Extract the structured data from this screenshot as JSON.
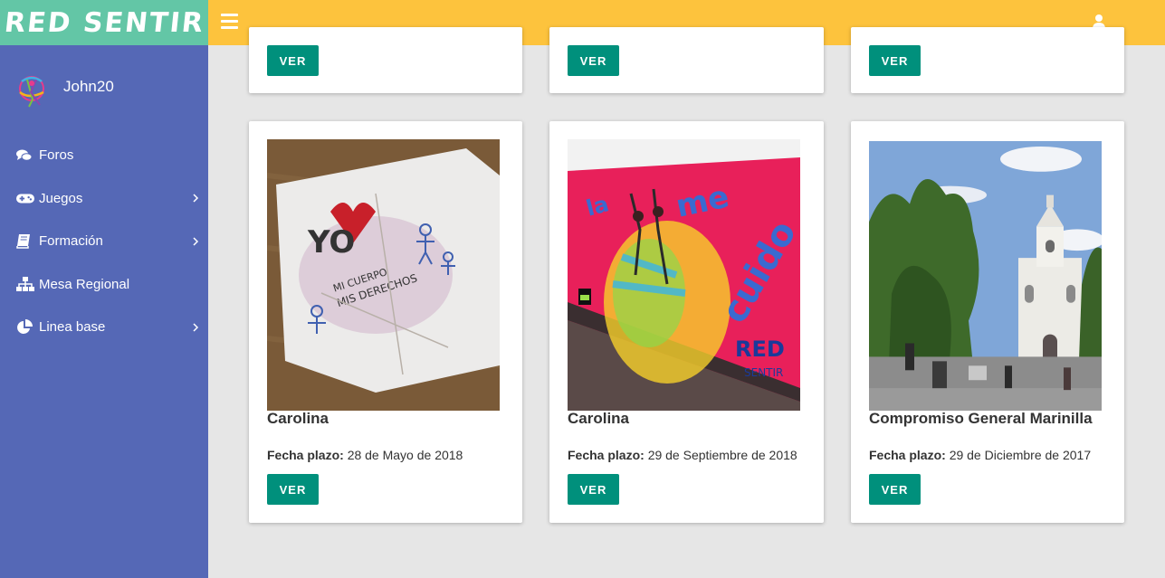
{
  "brand": {
    "name": "RED SENTIR"
  },
  "user": {
    "name": "John20"
  },
  "sidebar": {
    "items": [
      {
        "label": "Foros",
        "icon": "comments-icon",
        "has_submenu": false
      },
      {
        "label": "Juegos",
        "icon": "gamepad-icon",
        "has_submenu": true
      },
      {
        "label": "Formación",
        "icon": "book-icon",
        "has_submenu": true
      },
      {
        "label": "Mesa Regional",
        "icon": "sitemap-icon",
        "has_submenu": false
      },
      {
        "label": "Linea base",
        "icon": "pie-chart-icon",
        "has_submenu": true
      }
    ]
  },
  "cards_top": [
    {
      "button": "VER"
    },
    {
      "button": "VER"
    },
    {
      "button": "VER"
    }
  ],
  "cards": [
    {
      "title": "Carolina",
      "date_label": "Fecha plazo:",
      "date": "28 de Mayo de 2018",
      "button": "VER",
      "image": "drawing-yo-cuerpo-derechos"
    },
    {
      "title": "Carolina",
      "date_label": "Fecha plazo:",
      "date": "29 de Septiembre de 2018",
      "button": "VER",
      "image": "mural-me-cuido"
    },
    {
      "title": "Compromiso General Marinilla",
      "date_label": "Fecha plazo:",
      "date": "29 de Diciembre de 2017",
      "button": "VER",
      "image": "church-plaza-photo"
    }
  ],
  "colors": {
    "brand_green": "#63c6a6",
    "topbar_yellow": "#fdc33d",
    "sidebar_blue": "#5568b6",
    "button_teal": "#00907c",
    "background": "#e6e6e6"
  }
}
